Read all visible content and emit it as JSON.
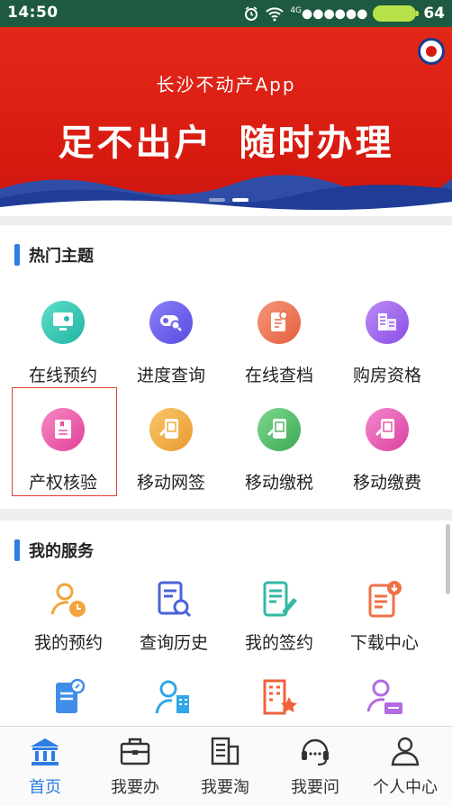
{
  "status_bar": {
    "time": "14:50",
    "network": "4G",
    "battery": "64"
  },
  "banner": {
    "subtitle": "长沙不动产App",
    "title": "足不出户 随时办理",
    "slide_count": 2,
    "active_slide": 2
  },
  "hot_topics": {
    "title": "热门主题",
    "items": [
      {
        "label": "在线预约",
        "icon": "monitor-icon",
        "color": "#36c6b4"
      },
      {
        "label": "进度查询",
        "icon": "progress-search-icon",
        "color": "#6f62ee"
      },
      {
        "label": "在线查档",
        "icon": "document-search-icon",
        "color": "#f07a57"
      },
      {
        "label": "购房资格",
        "icon": "building-qualification-icon",
        "color": "#a067f0"
      },
      {
        "label": "产权核验",
        "icon": "certificate-icon",
        "color": "#ef5aa8"
      },
      {
        "label": "移动网签",
        "icon": "phone-sign-icon",
        "color": "#f2b14a"
      },
      {
        "label": "移动缴税",
        "icon": "phone-tax-icon",
        "color": "#4fbf6a"
      },
      {
        "label": "移动缴费",
        "icon": "phone-payment-icon",
        "color": "#ea58b2"
      }
    ]
  },
  "my_services": {
    "title": "我的服务",
    "items": [
      {
        "label": "我的预约",
        "icon": "user-clock-icon",
        "color": "#f2a53a"
      },
      {
        "label": "查询历史",
        "icon": "history-search-icon",
        "color": "#4a63d8"
      },
      {
        "label": "我的签约",
        "icon": "contract-edit-icon",
        "color": "#33b9a3"
      },
      {
        "label": "下载中心",
        "icon": "download-doc-icon",
        "color": "#f07246"
      },
      {
        "label": "",
        "icon": "scroll-badge-icon",
        "color": "#3f8de8"
      },
      {
        "label": "",
        "icon": "user-building-icon",
        "color": "#2fa7e8"
      },
      {
        "label": "",
        "icon": "building-star-icon",
        "color": "#f0623b"
      },
      {
        "label": "",
        "icon": "user-message-icon",
        "color": "#b46be0"
      }
    ]
  },
  "bottom_nav": {
    "items": [
      {
        "label": "首页",
        "icon": "home-bank-icon",
        "active": true
      },
      {
        "label": "我要办",
        "icon": "briefcase-icon",
        "active": false
      },
      {
        "label": "我要淘",
        "icon": "building-list-icon",
        "active": false
      },
      {
        "label": "我要问",
        "icon": "headset-icon",
        "active": false
      },
      {
        "label": "个人中心",
        "icon": "person-icon",
        "active": false
      }
    ],
    "active_color": "#2e7de3"
  }
}
